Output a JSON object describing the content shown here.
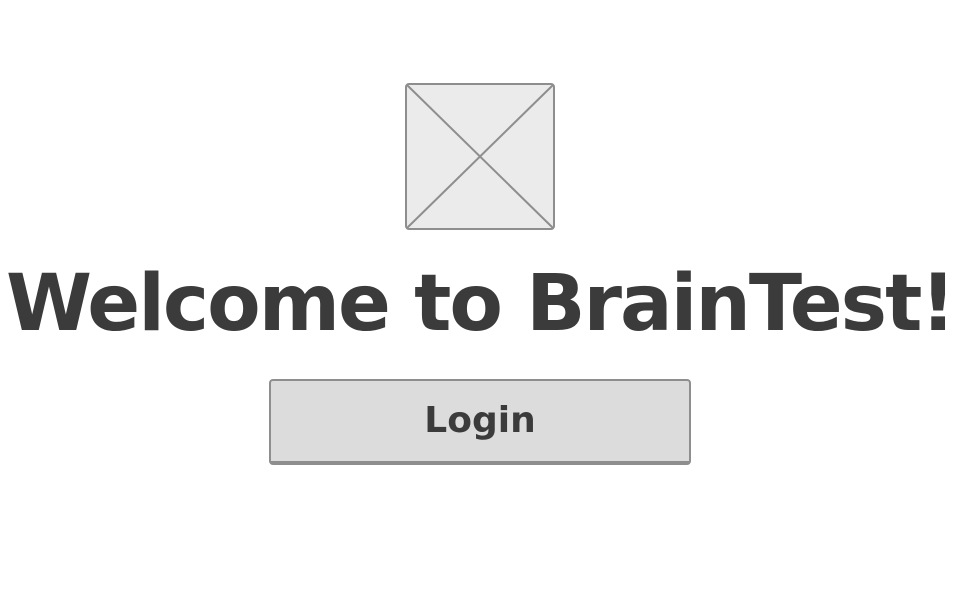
{
  "welcome": {
    "title": "Welcome to BrainTest!"
  },
  "image": {
    "icon": "image-placeholder-icon"
  },
  "login": {
    "label": "Login"
  },
  "colors": {
    "text": "#3b3b3b",
    "button_bg": "#dcdcdc",
    "button_border": "#8e8e8e",
    "placeholder_bg": "#ebebeb",
    "placeholder_stroke": "#8e8e8e"
  }
}
